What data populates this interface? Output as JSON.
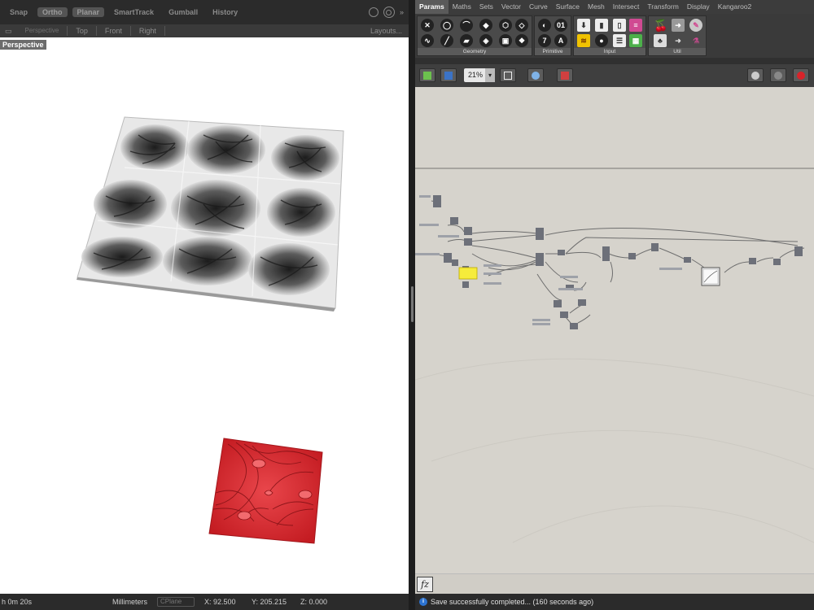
{
  "rhino": {
    "toolbar": {
      "items": [
        "Snap",
        "Ortho",
        "Planar",
        "SmartTrack",
        "Gumball",
        "History"
      ]
    },
    "viewtabs": {
      "first": "Perspective",
      "items": [
        "Top",
        "Front",
        "Right"
      ],
      "layouts": "Layouts..."
    },
    "viewport_label": "Perspective",
    "status": {
      "time": "h 0m 20s",
      "units": "Millimeters",
      "cplane": "CPlane",
      "x": "X: 92.500",
      "y": "Y: 205.215",
      "z": "Z: 0.000"
    }
  },
  "gh": {
    "tabs": [
      "Params",
      "Maths",
      "Sets",
      "Vector",
      "Curve",
      "Surface",
      "Mesh",
      "Intersect",
      "Transform",
      "Display",
      "Kangaroo2"
    ],
    "active_tab": "Params",
    "groups": [
      "Geometry",
      "Primitive",
      "Input",
      "Util"
    ],
    "zoom": "21%",
    "fx_label": "fz",
    "status": "Save successfully completed... (160 seconds ago)"
  },
  "colors": {
    "red_surface": "#d8232a",
    "yellow_panel": "#f6ec3b",
    "canvas": "#d6d3cc"
  }
}
